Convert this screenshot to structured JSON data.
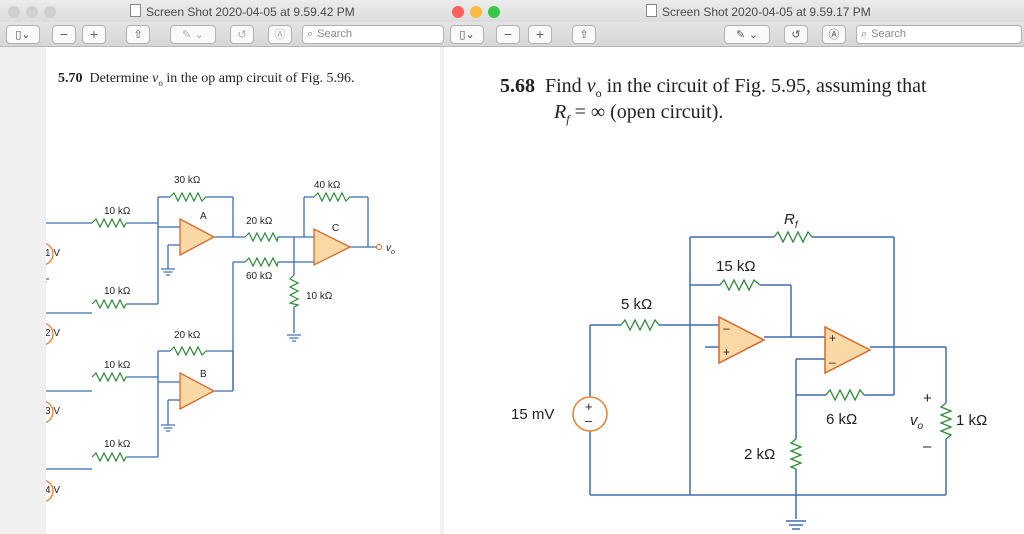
{
  "left_window": {
    "title": "Screen Shot 2020-04-05 at 9.59.42 PM",
    "search_placeholder": "Search",
    "problem": {
      "number": "5.70",
      "text_pre": "Determine",
      "var": "v",
      "sub": "o",
      "text_post": "in the op amp circuit of Fig. 5.96."
    },
    "circuit": {
      "sources": [
        "1 V",
        "2 V",
        "3 V",
        "4 V"
      ],
      "input_resistors": [
        "10 kΩ",
        "10 kΩ",
        "10 kΩ",
        "10 kΩ"
      ],
      "feedback_a": "30 kΩ",
      "feedback_b": "20 kΩ",
      "r_a_to_c": "20 kΩ",
      "r_b_to_c": "60 kΩ",
      "feedback_c": "40 kΩ",
      "r_c_ground": "10 kΩ",
      "opamp_labels": [
        "A",
        "B",
        "C"
      ],
      "output_label": "v",
      "output_sub": "o"
    }
  },
  "right_window": {
    "title": "Screen Shot 2020-04-05 at 9.59.17 PM",
    "search_placeholder": "Search",
    "problem": {
      "number": "5.68",
      "line1_pre": "Find",
      "var": "v",
      "sub": "o",
      "line1_post": "in the circuit of Fig. 5.95, assuming that",
      "line2_var": "R",
      "line2_sub": "f",
      "line2_post": "= ∞ (open circuit)."
    },
    "circuit": {
      "source": "15 mV",
      "r_in": "5 kΩ",
      "r_fb1": "15 kΩ",
      "r_f": "R",
      "r_f_sub": "f",
      "r_ground": "2 kΩ",
      "r_fb2": "6 kΩ",
      "r_load": "1 kΩ",
      "vo": "v",
      "vo_sub": "o",
      "plus": "+",
      "minus": "–"
    }
  },
  "colors": {
    "wire": "#3f6cb0",
    "resistor": "#2e8a3a",
    "opamp_fill": "#fbd9a6",
    "opamp_stroke": "#d7682d",
    "source_stroke": "#e0822f"
  }
}
